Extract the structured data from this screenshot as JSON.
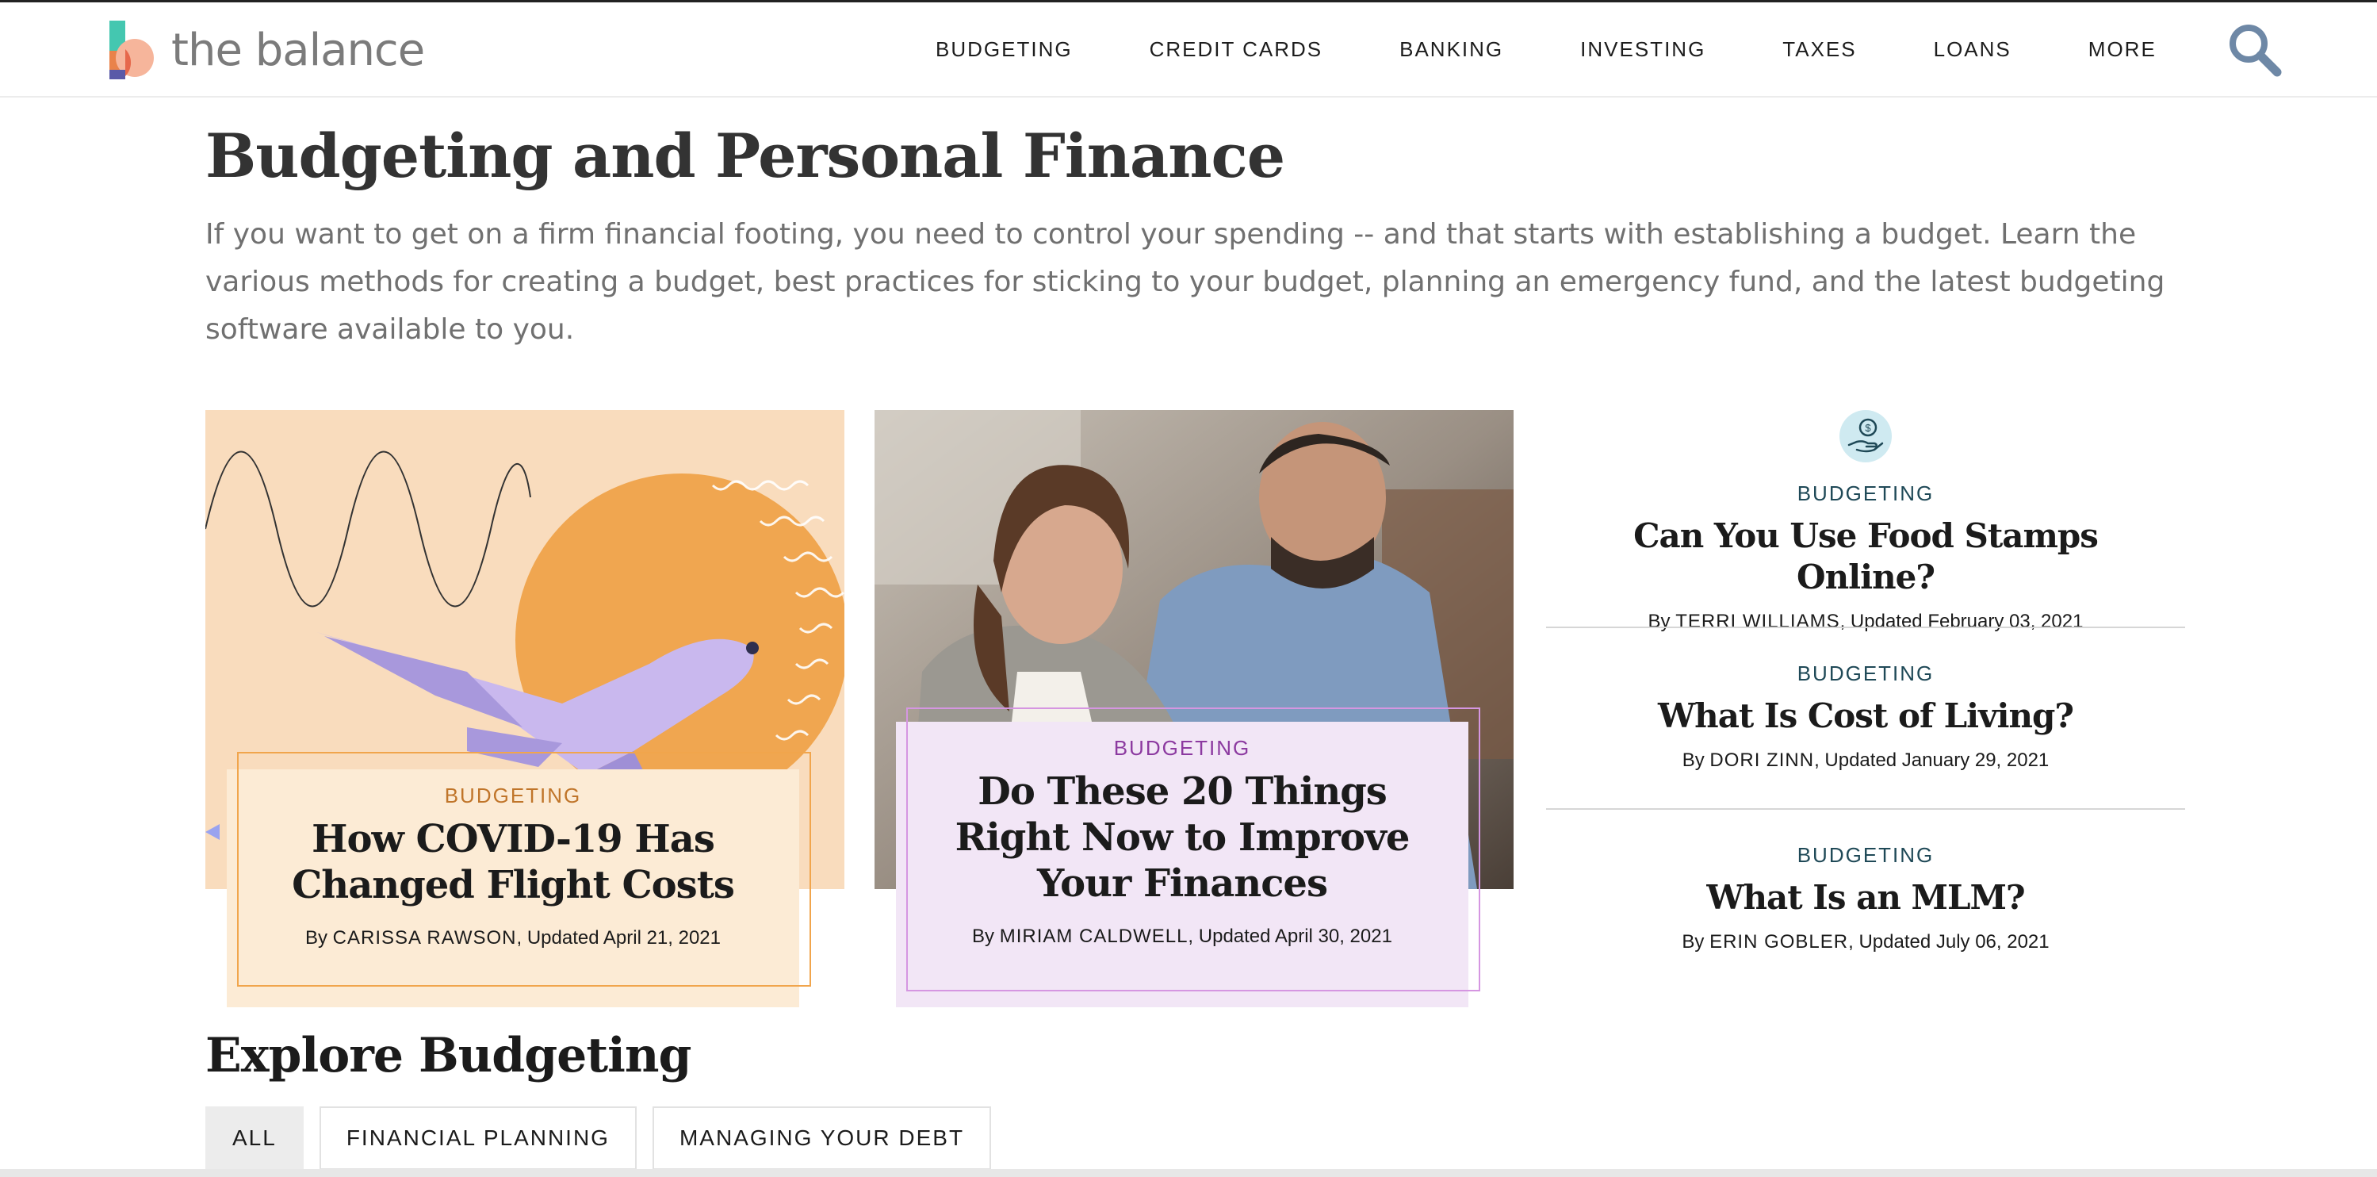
{
  "brand": {
    "name": "the balance"
  },
  "nav": {
    "items": [
      "BUDGETING",
      "CREDIT CARDS",
      "BANKING",
      "INVESTING",
      "TAXES",
      "LOANS",
      "MORE"
    ]
  },
  "page": {
    "title": "Budgeting and Personal Finance",
    "intro": "If you want to get on a firm financial footing, you need to control your spending -- and that starts with establishing a budget. Learn the various methods for creating a budget, best practices for sticking to your budget, planning an emergency fund, and the latest budgeting software available to you."
  },
  "featured": [
    {
      "category": "BUDGETING",
      "title": "How COVID-19 Has Changed Flight Costs",
      "by": "By",
      "author": "CARISSA RAWSON",
      "updated": ", Updated April 21, 2021"
    },
    {
      "category": "BUDGETING",
      "title": "Do These 20 Things Right Now to Improve Your Finances",
      "by": "By",
      "author": "MIRIAM CALDWELL",
      "updated": ", Updated April 30, 2021"
    }
  ],
  "side_articles": [
    {
      "category": "BUDGETING",
      "title": "Can You Use Food Stamps Online?",
      "by": "By",
      "author": "TERRI WILLIAMS",
      "updated": ", Updated February 03, 2021"
    },
    {
      "category": "BUDGETING",
      "title": "What Is Cost of Living?",
      "by": "By",
      "author": "DORI ZINN",
      "updated": ", Updated January 29, 2021"
    },
    {
      "category": "BUDGETING",
      "title": "What Is an MLM?",
      "by": "By",
      "author": "ERIN GOBLER",
      "updated": ", Updated July 06, 2021"
    }
  ],
  "explore": {
    "title": "Explore Budgeting",
    "tabs": [
      "ALL",
      "FINANCIAL PLANNING",
      "MANAGING YOUR DEBT"
    ],
    "active_tab": "ALL"
  },
  "colors": {
    "accent_orange": "#c0752a",
    "accent_purple": "#8c3aa0",
    "accent_teal": "#1f4957",
    "search_icon": "#6e88a6"
  },
  "icons": {
    "search": "search-icon",
    "side_topic": "hand-holding-dollar-icon"
  }
}
